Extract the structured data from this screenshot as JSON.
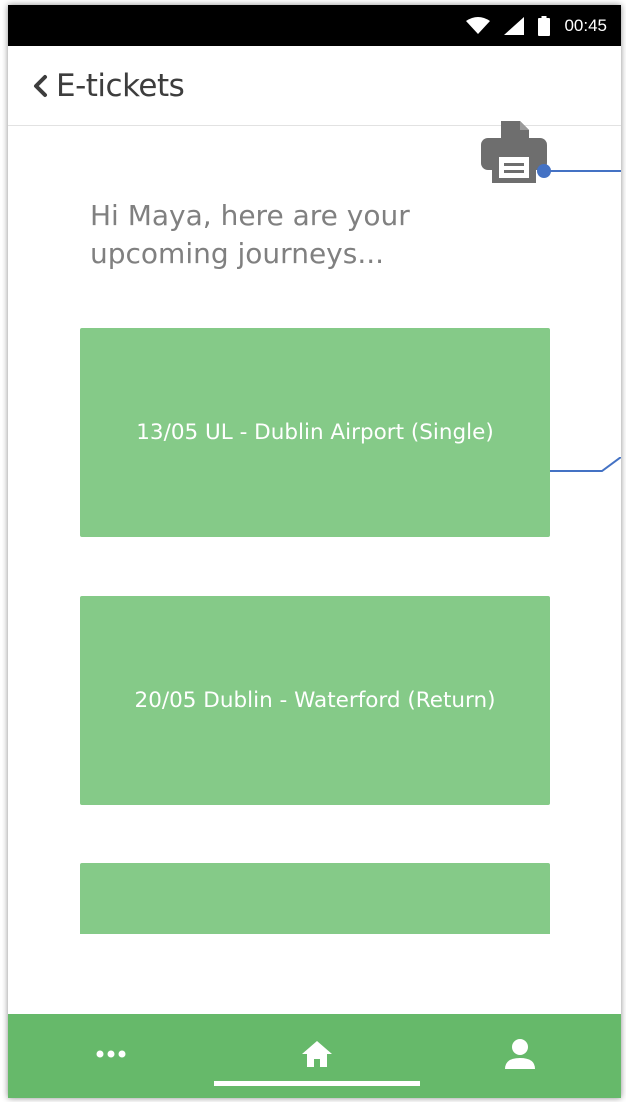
{
  "status_bar": {
    "time": "00:45",
    "icons": [
      "wifi-icon",
      "signal-icon",
      "battery-icon"
    ]
  },
  "header": {
    "back_icon": "chevron-left-icon",
    "title": "E-tickets"
  },
  "toolbar": {
    "print_icon": "printer-icon"
  },
  "main": {
    "greeting": "Hi Maya, here are your upcoming journeys...",
    "tickets": [
      {
        "label": "13/05 UL  - Dublin Airport (Single)"
      },
      {
        "label": "20/05 Dublin - Waterford (Return)"
      },
      {
        "label": ""
      }
    ]
  },
  "bottom_nav": {
    "items": [
      {
        "icon": "more-icon"
      },
      {
        "icon": "home-icon",
        "active": true
      },
      {
        "icon": "profile-icon"
      }
    ]
  },
  "colors": {
    "status_bar": "#000000",
    "ticket": "#85ca88",
    "bottom_nav": "#66b96a",
    "annotation": "#4472c4",
    "printer": "#6e6e6e"
  }
}
